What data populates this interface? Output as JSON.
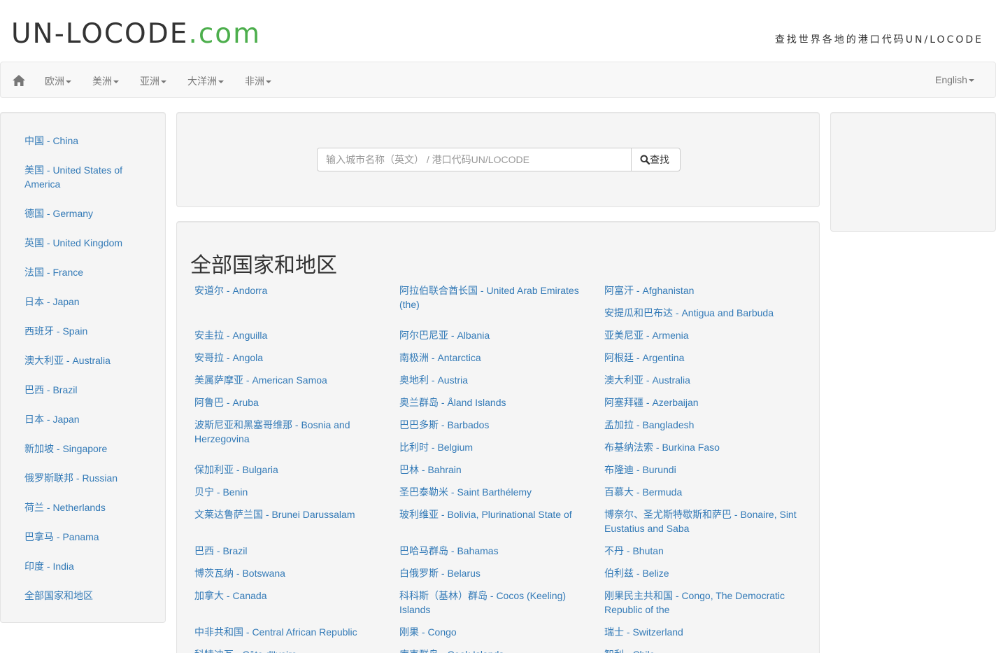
{
  "header": {
    "logo_main": "UN-LOCODE",
    "logo_tld": ".com",
    "tagline": "查找世界各地的港口代码UN/LOCODE"
  },
  "nav": {
    "home_icon": "home-icon",
    "items": [
      "欧洲",
      "美洲",
      "亚洲",
      "大洋洲",
      "非洲"
    ],
    "language": "English"
  },
  "sidebar": {
    "items": [
      "中国 - China",
      "美国 - United States of America",
      "德国 - Germany",
      "英国 - United Kingdom",
      "法国 - France",
      "日本 - Japan",
      "西班牙 - Spain",
      "澳大利亚 - Australia",
      "巴西 - Brazil",
      "日本 - Japan",
      "新加坡 - Singapore",
      "俄罗斯联邦 - Russian",
      "荷兰 - Netherlands",
      "巴拿马 - Panama",
      "印度 - India",
      "全部国家和地区"
    ]
  },
  "search": {
    "placeholder": "输入城市名称（英文） / 港口代码UN/LOCODE",
    "value": "",
    "button_label": "查找"
  },
  "countries": {
    "title": "全部国家和地区",
    "col1": [
      "安道尔 - Andorra",
      "安圭拉 - Anguilla",
      "安哥拉 - Angola",
      "美属萨摩亚 - American Samoa",
      "阿鲁巴 - Aruba",
      "波斯尼亚和黑塞哥维那 - Bosnia and Herzegovina",
      "保加利亚 - Bulgaria",
      "贝宁 - Benin",
      "文莱达鲁萨兰国 - Brunei Darussalam",
      "巴西 - Brazil",
      "博茨瓦纳 - Botswana",
      "加拿大 - Canada",
      "中非共和国 - Central African Republic",
      "科特迪瓦 - Côte d'Ivoire"
    ],
    "col2": [
      "阿拉伯联合酋长国 - United Arab Emirates (the)",
      "阿尔巴尼亚 - Albania",
      "南极洲 - Antarctica",
      "奥地利 - Austria",
      "奥兰群岛 - Åland Islands",
      "巴巴多斯 - Barbados",
      "比利时 - Belgium",
      "巴林 - Bahrain",
      "圣巴泰勒米 - Saint Barthélemy",
      "玻利维亚 - Bolivia, Plurinational State of",
      "巴哈马群岛 - Bahamas",
      "白俄罗斯 - Belarus",
      "科科斯（基林）群岛 - Cocos (Keeling) Islands",
      "刚果 - Congo",
      "库克群岛 - Cook Islands"
    ],
    "col3": [
      "阿富汗 - Afghanistan",
      "安提瓜和巴布达 - Antigua and Barbuda",
      "亚美尼亚 - Armenia",
      "阿根廷 - Argentina",
      "澳大利亚 - Australia",
      "阿塞拜疆 - Azerbaijan",
      "孟加拉 - Bangladesh",
      "布基纳法索 - Burkina Faso",
      "布隆迪 - Burundi",
      "百慕大 - Bermuda",
      "博奈尔、圣尤斯特歇斯和萨巴 - Bonaire, Sint Eustatius and Saba",
      "不丹 - Bhutan",
      "伯利兹 - Belize",
      "刚果民主共和国 - Congo, The Democratic Republic of the",
      "瑞士 - Switzerland",
      "智利 - Chile"
    ]
  }
}
